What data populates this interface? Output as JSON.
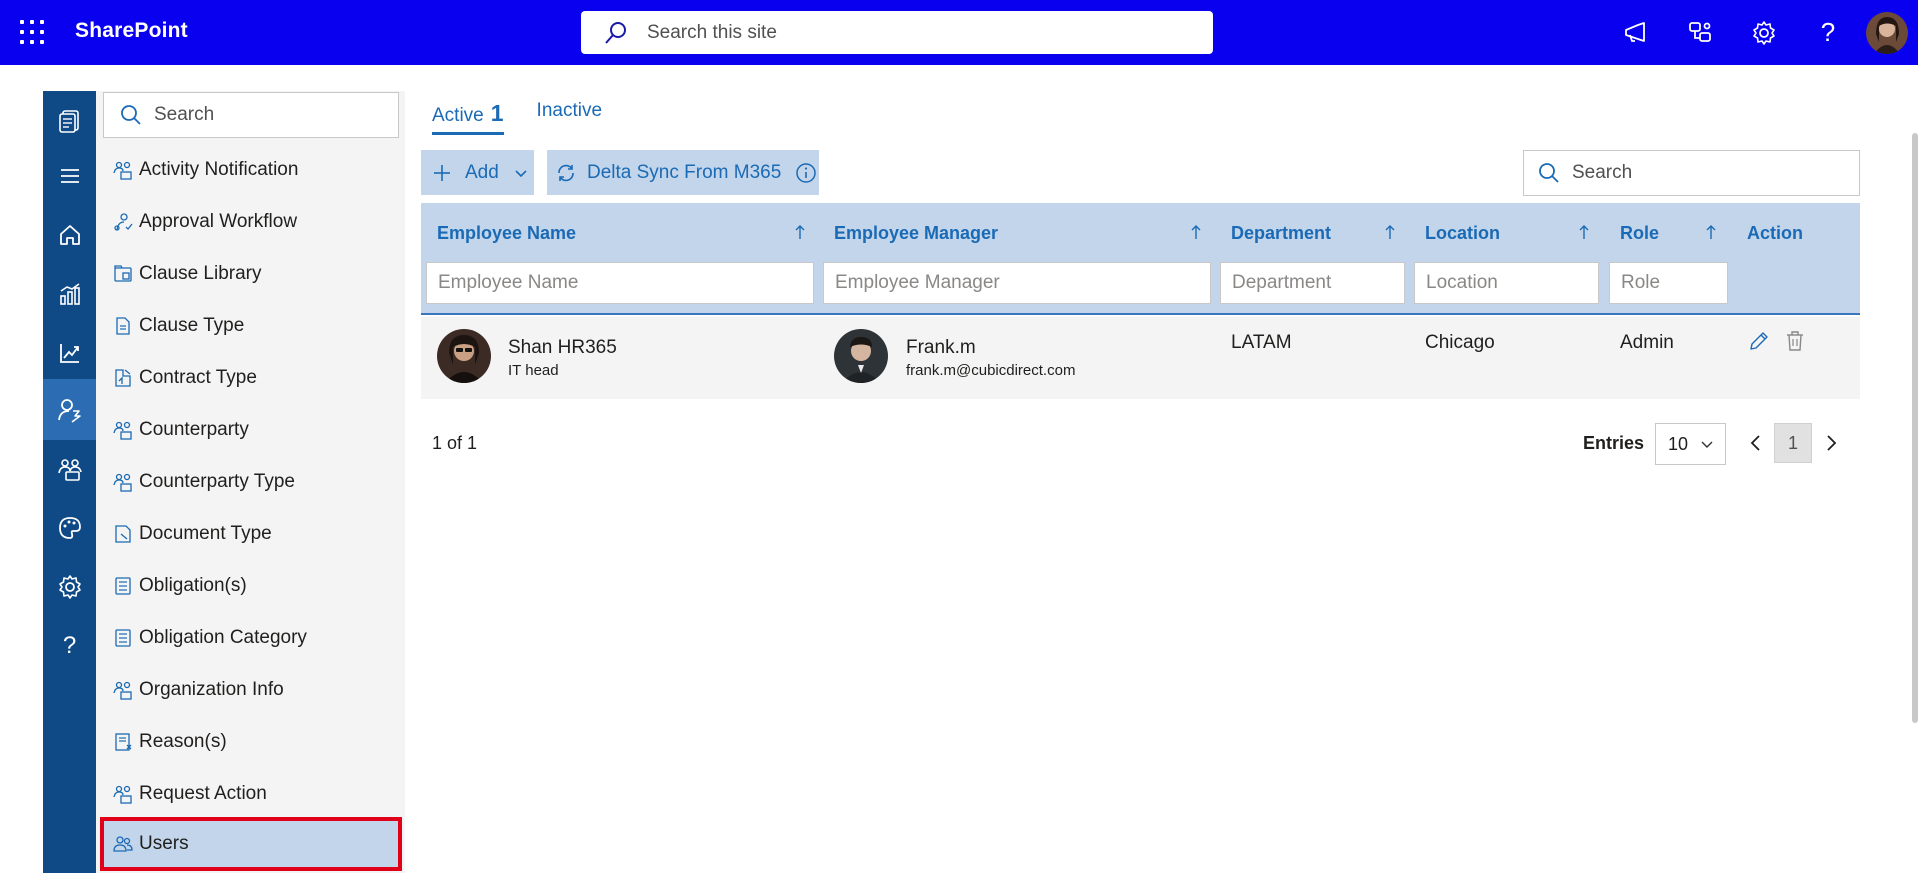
{
  "suite": {
    "app_name": "SharePoint",
    "search_placeholder": "Search this site",
    "icons": [
      "waffle-icon",
      "megaphone-icon",
      "app-switch-icon",
      "gear-icon",
      "help-icon",
      "avatar"
    ],
    "help_glyph": "?",
    "bar_color": "#0a00f0"
  },
  "rail": {
    "items": [
      "documents-logo-icon",
      "menu-icon",
      "home-icon",
      "dashboard-chart-icon",
      "trend-chart-icon",
      "user-settings-icon",
      "people-group-icon",
      "palette-icon",
      "gear-icon",
      "help-icon"
    ],
    "help_glyph": "?",
    "active_item": "user-settings-icon",
    "color": "#0f4a87"
  },
  "nav": {
    "search_placeholder": "Search",
    "items": [
      {
        "label": "Activity Notification",
        "icon": "people-icon"
      },
      {
        "label": "Approval Workflow",
        "icon": "workflow-icon"
      },
      {
        "label": "Clause Library",
        "icon": "library-icon"
      },
      {
        "label": "Clause Type",
        "icon": "document-icon"
      },
      {
        "label": "Contract Type",
        "icon": "contract-icon"
      },
      {
        "label": "Counterparty",
        "icon": "people-icon"
      },
      {
        "label": "Counterparty Type",
        "icon": "people-icon"
      },
      {
        "label": "Document Type",
        "icon": "document-type-icon"
      },
      {
        "label": "Obligation(s)",
        "icon": "list-doc-icon"
      },
      {
        "label": "Obligation Category",
        "icon": "list-doc-icon"
      },
      {
        "label": "Organization Info",
        "icon": "people-icon"
      },
      {
        "label": "Reason(s)",
        "icon": "reason-icon"
      },
      {
        "label": "Request Action",
        "icon": "people-icon"
      },
      {
        "label": "Users",
        "icon": "users-icon"
      }
    ],
    "selected": "Users"
  },
  "tabs": [
    {
      "label": "Active",
      "count": "1",
      "active": true
    },
    {
      "label": "Inactive",
      "active": false
    }
  ],
  "toolbar": {
    "add_label": "Add",
    "sync_label": "Delta Sync From M365",
    "search_placeholder": "Search"
  },
  "table": {
    "columns": [
      {
        "label": "Employee Name",
        "filter_placeholder": "Employee Name"
      },
      {
        "label": "Employee Manager",
        "filter_placeholder": "Employee Manager"
      },
      {
        "label": "Department",
        "filter_placeholder": "Department"
      },
      {
        "label": "Location",
        "filter_placeholder": "Location"
      },
      {
        "label": "Role",
        "filter_placeholder": "Role"
      },
      {
        "label": "Action"
      }
    ],
    "rows": [
      {
        "employee_name": "Shan HR365",
        "employee_title": "IT head",
        "manager_name": "Frank.m",
        "manager_email": "frank.m@cubicdirect.com",
        "department": "LATAM",
        "location": "Chicago",
        "role": "Admin"
      }
    ]
  },
  "pager": {
    "summary": "1 of 1",
    "entries_label": "Entries",
    "entries_value": "10",
    "current_page": "1"
  },
  "colors": {
    "accent": "#1b6ab5",
    "header_bg": "#c2d5eb",
    "selection_outline": "#e0001a"
  }
}
